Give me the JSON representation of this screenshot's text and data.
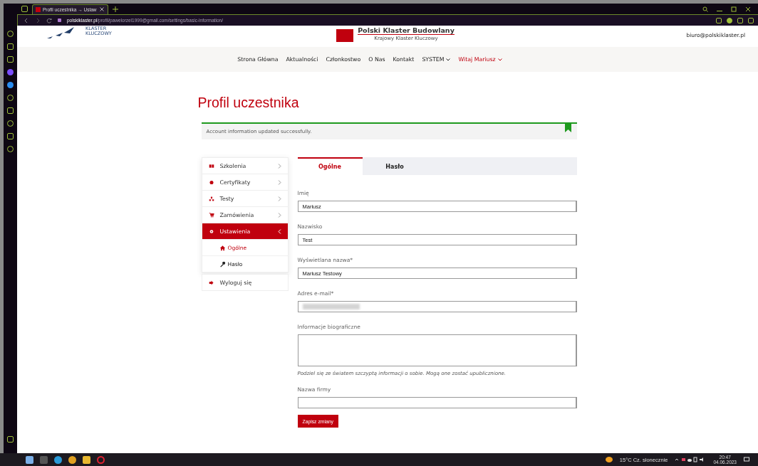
{
  "browser": {
    "tab_title": "Profil uczestnika → Ustaw",
    "url_host": "polskiklaster.pl",
    "url_path": "/profil/pawelorzel1999@gmail.com/settings/basic-information/"
  },
  "header": {
    "left_logo_lines": [
      "KLASTER",
      "KLUCZOWY"
    ],
    "center_logo_title": "Polski Klaster Budowlany",
    "center_logo_subtitle": "Krajowy  Klaster  Kluczowy",
    "email": "biuro@polskiklaster.pl"
  },
  "nav": [
    {
      "label": "Strona Główna",
      "dropdown": false,
      "accent": false
    },
    {
      "label": "Aktualności",
      "dropdown": false,
      "accent": false
    },
    {
      "label": "Członkostwo",
      "dropdown": false,
      "accent": false
    },
    {
      "label": "O Nas",
      "dropdown": false,
      "accent": false
    },
    {
      "label": "Kontakt",
      "dropdown": false,
      "accent": false
    },
    {
      "label": "SYSTEM",
      "dropdown": true,
      "accent": false
    },
    {
      "label": "Witaj Mariusz",
      "dropdown": true,
      "accent": true
    }
  ],
  "page_title": "Profil uczestnika",
  "notice": "Account information updated successfully.",
  "side_menu": [
    {
      "label": "Szkolenia",
      "selected": false,
      "expanded": false
    },
    {
      "label": "Certyfikaty",
      "selected": false,
      "expanded": false
    },
    {
      "label": "Testy",
      "selected": false,
      "expanded": false
    },
    {
      "label": "Zamówienia",
      "selected": false,
      "expanded": false
    },
    {
      "label": "Ustawienia",
      "selected": true,
      "expanded": true,
      "children": [
        {
          "label": "Ogólne",
          "selected": true
        },
        {
          "label": "Hasło",
          "selected": false
        }
      ]
    }
  ],
  "logout": "Wyloguj się",
  "tabs": [
    {
      "label": "Ogólne",
      "selected": true
    },
    {
      "label": "Hasło",
      "selected": false
    }
  ],
  "fields": [
    {
      "kind": "text",
      "label": "Imię",
      "value": "Mariusz"
    },
    {
      "kind": "text",
      "label": "Nazwisko",
      "value": "Test"
    },
    {
      "kind": "text",
      "label": "Wyświetlana nazwa*",
      "value": "Mariusz Testowy"
    },
    {
      "kind": "redacted",
      "label": "Adres e-mail*"
    },
    {
      "kind": "textarea",
      "label": "Informacje biograficzne",
      "hint": "Podziel się ze światem szczyptą informacji o sobie. Mogą one zostać upublicznione."
    },
    {
      "kind": "text",
      "label": "Nazwa firmy"
    }
  ],
  "save_button": "Zapisz zmiany",
  "taskbar": {
    "weather": "15°C  Cz. słonecznie",
    "time": "20:47",
    "date": "04.06.2023"
  }
}
